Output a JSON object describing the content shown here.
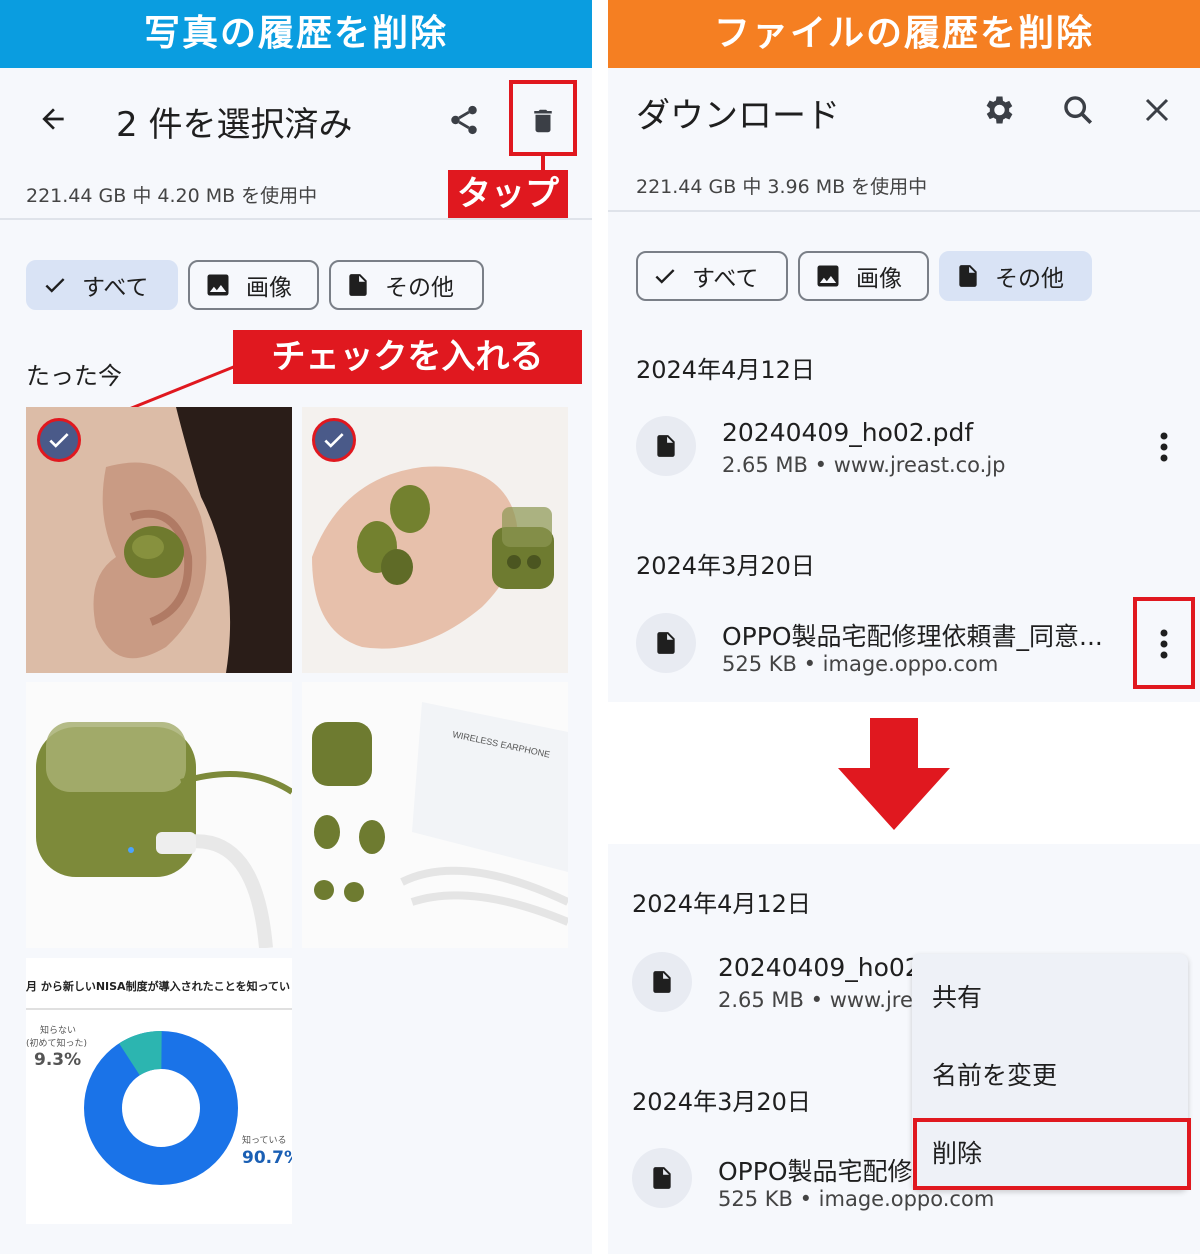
{
  "left": {
    "banner": "写真の履歴を削除",
    "header": {
      "title": "2 件を選択済み"
    },
    "storage": "221.44 GB 中 4.20 MB を使用中",
    "filters": [
      {
        "label": "すべて",
        "selected": true
      },
      {
        "label": "画像",
        "selected": false
      },
      {
        "label": "その他",
        "selected": false
      }
    ],
    "section_title": "たった今",
    "annotation_tap": "タップ",
    "annotation_check": "チェックを入れる",
    "thumb5": {
      "headline": "月 から新しいNISA制度が導入されたことを知ってい",
      "unknown_label_1": "知らない",
      "unknown_label_2": "(初めて知った)",
      "unknown_value": "9.3%",
      "known_label": "知っている",
      "known_value": "90.7%"
    },
    "thumb4": {
      "caption": "WIRELESS EARPHONE"
    }
  },
  "right": {
    "banner": "ファイルの履歴を削除",
    "header": {
      "title": "ダウンロード"
    },
    "storage": "221.44 GB 中 3.96 MB を使用中",
    "filters": [
      {
        "label": "すべて",
        "selected": false
      },
      {
        "label": "画像",
        "selected": false
      },
      {
        "label": "その他",
        "selected": true
      }
    ],
    "top": {
      "date1": "2024年4月12日",
      "file1": {
        "name": "20240409_ho02.pdf",
        "meta": "2.65 MB • www.jreast.co.jp"
      },
      "date2": "2024年3月20日",
      "file2": {
        "name": "OPPO製品宅配修理依頼書_同意...",
        "meta": "525 KB • image.oppo.com"
      }
    },
    "bottom": {
      "date1": "2024年4月12日",
      "file1": {
        "name": "20240409_ho02.",
        "meta": "2.65 MB • www.jrea"
      },
      "date2": "2024年3月20日",
      "file2": {
        "name": "OPPO製品宅配修",
        "meta": "525 KB • image.oppo.com"
      }
    },
    "menu": [
      "共有",
      "名前を変更",
      "削除"
    ]
  },
  "colors": {
    "blue_banner": "#0a9de0",
    "orange_banner": "#f57f22",
    "annotation_red": "#e0181f",
    "chip_selected": "#d9e3f5"
  }
}
